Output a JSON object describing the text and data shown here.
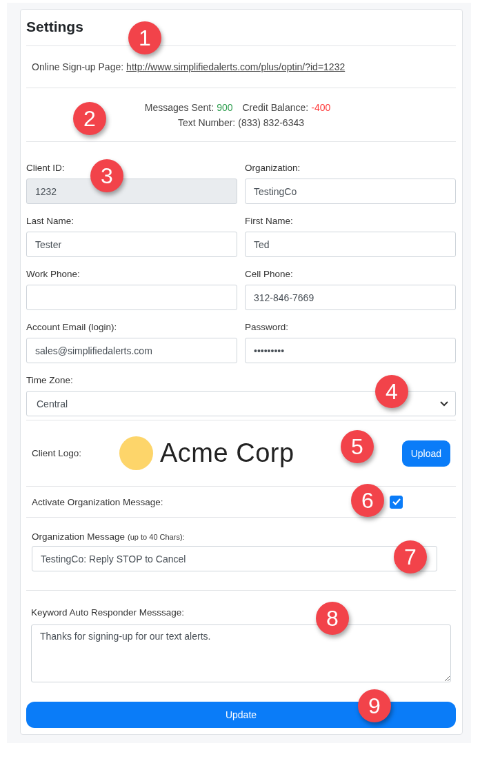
{
  "title": "Settings",
  "signup": {
    "label": "Online Sign-up Page:",
    "url": "http://www.simplifiedalerts.com/plus/optin/?id=1232"
  },
  "stats": {
    "sent_label": "Messages Sent:",
    "sent": "900",
    "balance_label": "Credit Balance:",
    "balance": "-400",
    "number_label": "Text Number:",
    "number": "(833) 832-6343"
  },
  "fields": [
    {
      "label": "Client ID:",
      "value": "1232",
      "disabled": true
    },
    {
      "label": "Organization:",
      "value": "TestingCo",
      "disabled": false
    },
    {
      "label": "Last Name:",
      "value": "Tester",
      "disabled": false
    },
    {
      "label": "First Name:",
      "value": "Ted",
      "disabled": false
    },
    {
      "label": "Work Phone:",
      "disabled": false
    },
    {
      "label": "Cell Phone:",
      "value": "312-846-7669",
      "disabled": false
    },
    {
      "label": "Account Email (login):",
      "value": "sales@simplifiedalerts.com",
      "disabled": false
    },
    {
      "label": "Password:",
      "value": "•••••••••",
      "disabled": false
    }
  ],
  "time_zone": {
    "label": "Time Zone:",
    "value": "Central"
  },
  "logo": {
    "label": "Client Logo:",
    "name": "Acme Corp",
    "upload": "Upload"
  },
  "activate": {
    "label": "Activate Organization Message:",
    "checked": true
  },
  "org_message": {
    "label": "Organization Message",
    "note": "(up to 40 Chars):",
    "value": "TestingCo: Reply STOP to Cancel"
  },
  "keyword": {
    "label": "Keyword Auto Responder Messsage:",
    "value": "Thanks for signing-up for our text alerts."
  },
  "update": "Update",
  "markers": [
    "1",
    "2",
    "3",
    "4",
    "5",
    "6",
    "7",
    "8",
    "9"
  ]
}
